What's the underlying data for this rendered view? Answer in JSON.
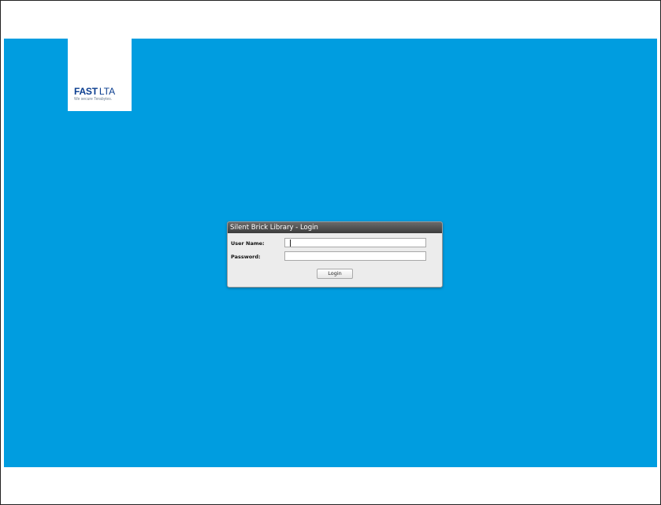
{
  "logo": {
    "brand_bold": "FAST",
    "brand_light": "LTA",
    "tagline": "We secure Terabytes."
  },
  "dialog": {
    "title": "Silent Brick Library - Login",
    "username_label": "User Name:",
    "username_value": "",
    "password_label": "Password:",
    "password_value": "",
    "login_button": "Login"
  },
  "colors": {
    "background": "#009de0",
    "brand": "#0a3d8f"
  }
}
